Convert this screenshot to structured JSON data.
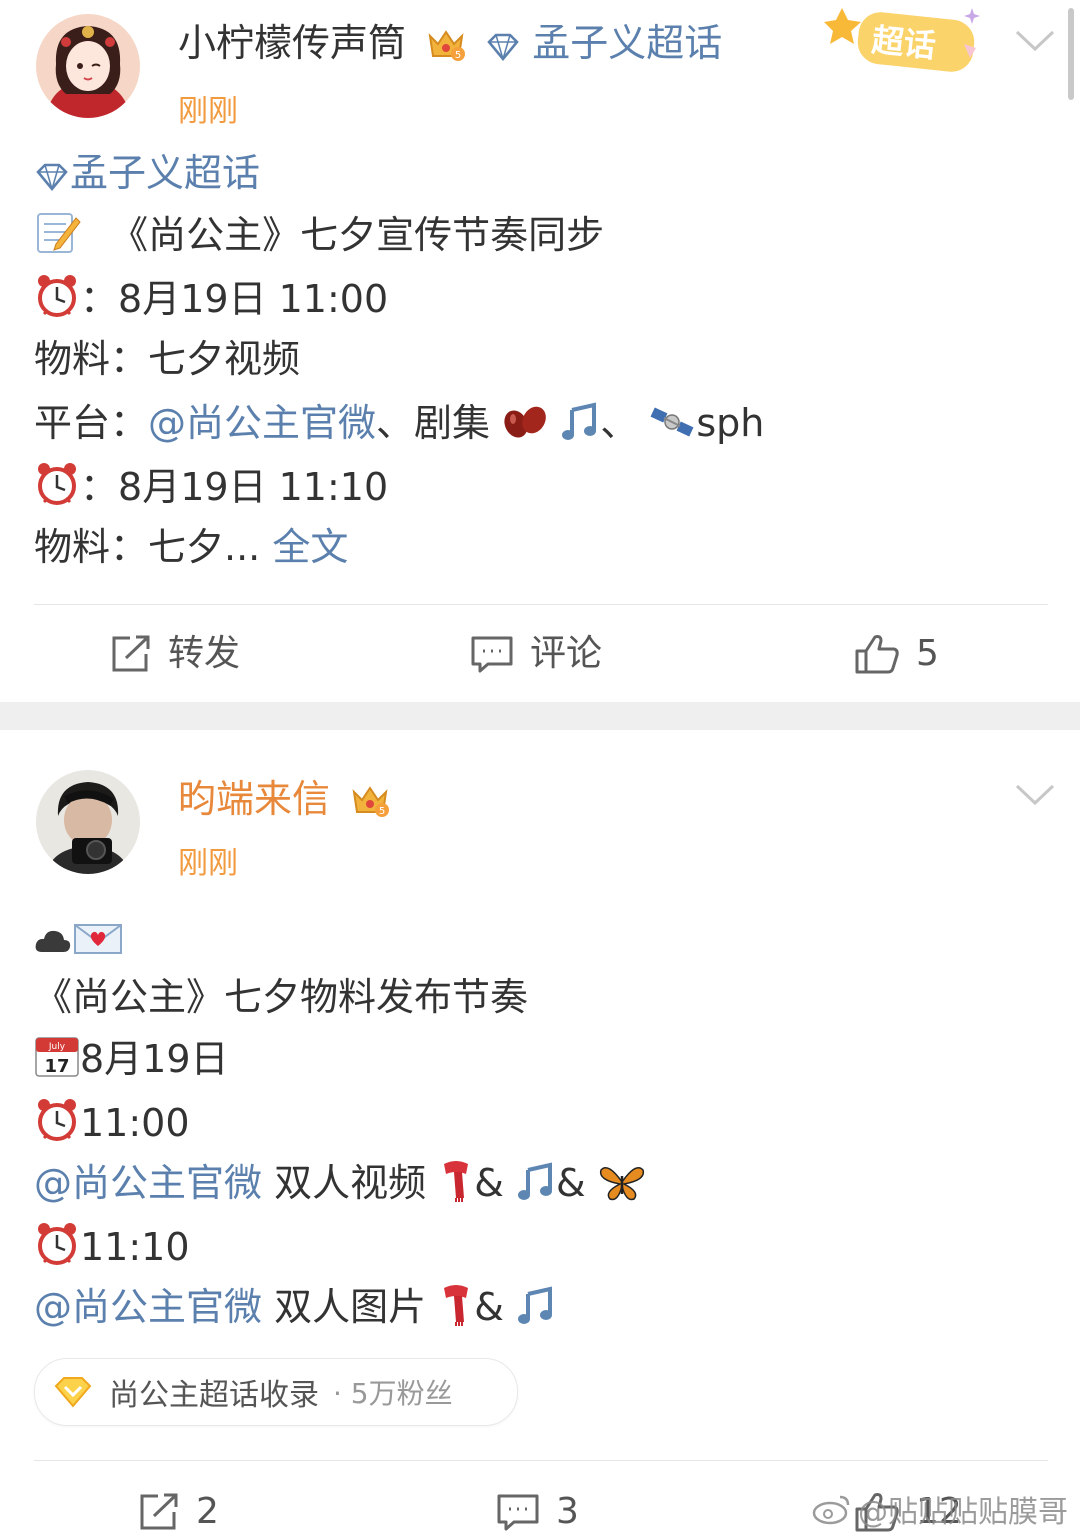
{
  "post1": {
    "username": "小柠檬传声筒",
    "topic_tag": "孟子义超话",
    "time": "刚刚",
    "badge_text": "超话",
    "lines": {
      "topic": "孟子义超话",
      "title": "《尚公主》七夕宣传节奏同步",
      "colon": "：",
      "time1": "8月19日 11:00",
      "material1": "物料：七夕视频",
      "platform_label": "平台：",
      "platform_link": "@尚公主官微",
      "platform_sep1": "、剧集",
      "platform_sep2": "、",
      "platform_sph": "sph",
      "time2": "8月19日 11:10",
      "material2_prefix": "物料：七夕... ",
      "full_text": "全文"
    },
    "actions": {
      "repost": "转发",
      "comment": "评论",
      "like_count": "5"
    }
  },
  "post2": {
    "username": "昀端来信",
    "time": "刚刚",
    "lines": {
      "title": "《尚公主》七夕物料发布节奏",
      "date": "8月19日",
      "calendar_month": "July",
      "calendar_day": "17",
      "time1": "11:00",
      "mention1": "@尚公主官微",
      "desc1": " 双人视频",
      "amp": "&",
      "time2": "11:10",
      "mention2": "@尚公主官微",
      "desc2": " 双人图片"
    },
    "chip": {
      "title": "尚公主超话收录",
      "fans": "· 5万粉丝"
    },
    "actions": {
      "repost_count": "2",
      "comment_count": "3",
      "like_count": "12"
    }
  },
  "watermark": "@贴贴贴贴膜哥",
  "colors": {
    "link": "#5b80ad",
    "gold_name": "#e8883a",
    "time": "#f19a3e"
  },
  "icons": [
    "crown-icon",
    "diamond-icon",
    "chevron-down-icon",
    "memo-icon",
    "alarm-clock-icon",
    "beans-icon",
    "music-note-icon",
    "satellite-icon",
    "cloud-icon",
    "love-letter-icon",
    "calendar-icon",
    "scarf-icon",
    "butterfly-icon",
    "repost-icon",
    "comment-icon",
    "like-icon"
  ]
}
